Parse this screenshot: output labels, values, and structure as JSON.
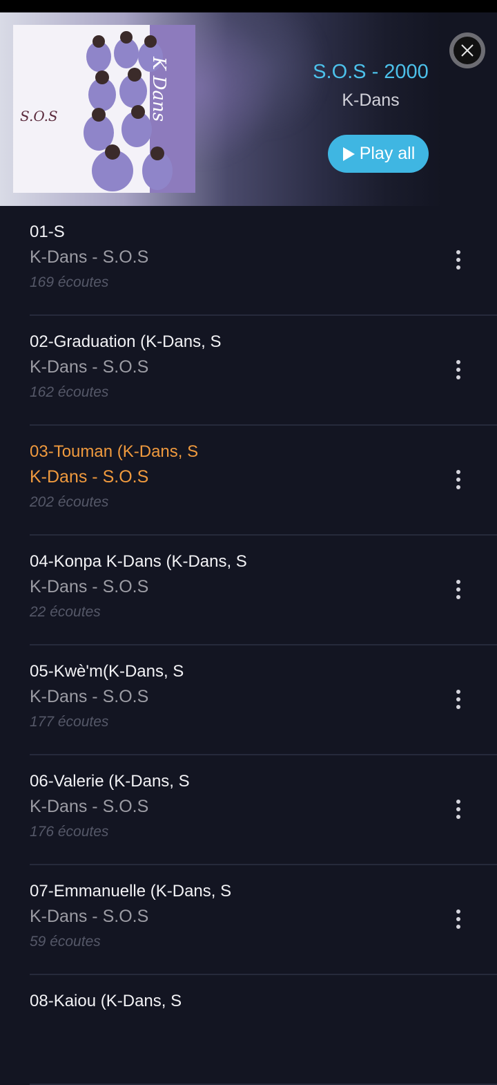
{
  "header": {
    "album_title": "S.O.S - 2000",
    "album_artist": "K-Dans",
    "play_all_label": "Play all",
    "album_art": {
      "side_text": "K Dans",
      "left_text": "S.O.S"
    },
    "icons": {
      "close": "close-icon",
      "play": "play-icon"
    }
  },
  "tracks": [
    {
      "title": "01-S",
      "subtitle": "K-Dans - S.O.S",
      "plays": "169 écoutes",
      "active": false
    },
    {
      "title": "02-Graduation (K-Dans, S",
      "subtitle": "K-Dans - S.O.S",
      "plays": "162 écoutes",
      "active": false
    },
    {
      "title": "03-Touman (K-Dans, S",
      "subtitle": "K-Dans - S.O.S",
      "plays": "202 écoutes",
      "active": true
    },
    {
      "title": "04-Konpa K-Dans (K-Dans, S",
      "subtitle": "K-Dans - S.O.S",
      "plays": "22 écoutes",
      "active": false
    },
    {
      "title": "05-Kwè'm(K-Dans, S",
      "subtitle": "K-Dans - S.O.S",
      "plays": "177 écoutes",
      "active": false
    },
    {
      "title": "06-Valerie (K-Dans, S",
      "subtitle": "K-Dans - S.O.S",
      "plays": "176 écoutes",
      "active": false
    },
    {
      "title": "07-Emmanuelle (K-Dans, S",
      "subtitle": "K-Dans - S.O.S",
      "plays": "59 écoutes",
      "active": false
    },
    {
      "title": "08-Kaiou (K-Dans, S",
      "subtitle": "",
      "plays": "",
      "active": false
    }
  ],
  "colors": {
    "accent": "#4cc1ea",
    "active_track": "#f09a3e",
    "background": "#131522"
  }
}
